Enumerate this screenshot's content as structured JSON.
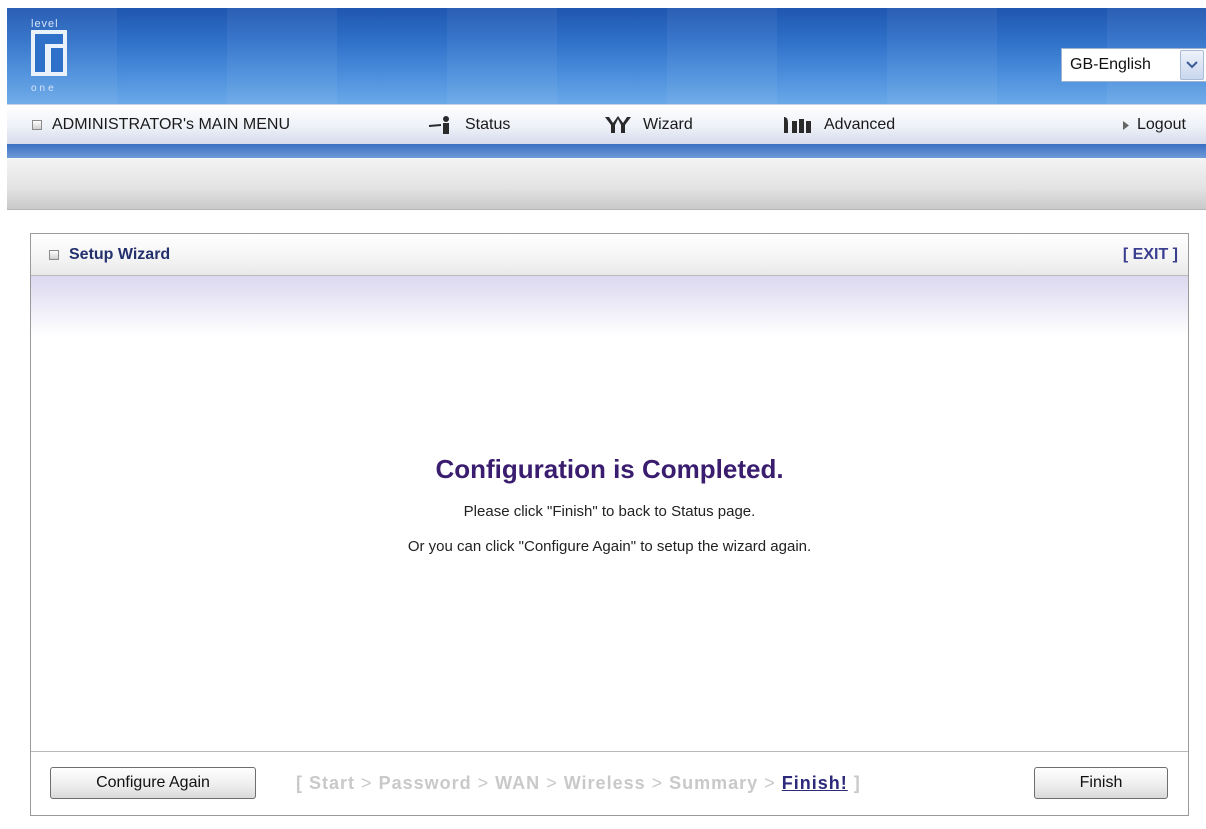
{
  "header": {
    "logo": {
      "top": "level",
      "bottom": "one"
    },
    "language": {
      "selected": "GB-English"
    }
  },
  "menu": {
    "main_title": "ADMINISTRATOR's MAIN MENU",
    "items": [
      {
        "label": "Status",
        "icon": "status-person-icon"
      },
      {
        "label": "Wizard",
        "icon": "wizard-icon"
      },
      {
        "label": "Advanced",
        "icon": "advanced-icon"
      }
    ],
    "logout": "Logout"
  },
  "wizard": {
    "title": "Setup Wizard",
    "exit_label": "[ EXIT ]",
    "heading": "Configuration is Completed.",
    "line1": "Please click \"Finish\" to back to Status page.",
    "line2": "Or you can click \"Configure Again\" to setup the wizard again.",
    "configure_again_label": "Configure Again",
    "finish_label": "Finish",
    "steps": {
      "open": "[",
      "items": [
        "Start",
        "Password",
        "WAN",
        "Wireless",
        "Summary"
      ],
      "separator": ">",
      "current": "Finish!",
      "close": "]"
    }
  },
  "colors": {
    "header_blue": "#2f71c9",
    "heading_purple": "#3a1d6e",
    "inactive_step": "#c9c9c9"
  }
}
